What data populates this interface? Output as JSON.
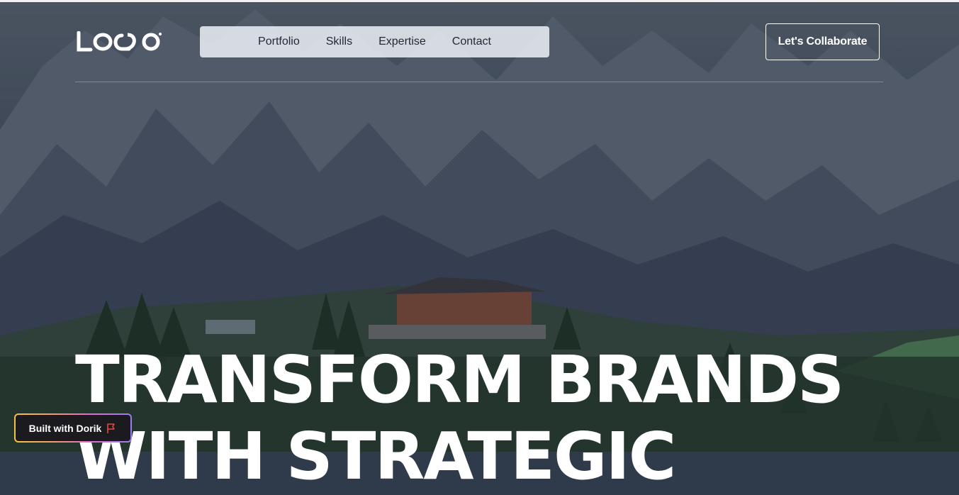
{
  "header": {
    "logo_text": "LOQO",
    "nav": [
      {
        "label": "Portfolio"
      },
      {
        "label": "Skills"
      },
      {
        "label": "Expertise"
      },
      {
        "label": "Contact"
      }
    ],
    "cta_label": "Let's Collaborate"
  },
  "hero": {
    "headline_line1": "TRANSFORM BRANDS",
    "headline_line2": "WITH STRATEGIC",
    "background": "mountain landscape with alpine lodge and pine trees"
  },
  "badge": {
    "label": "Built with Dorik",
    "icon": "flag-icon",
    "icon_color": "#e8473f"
  },
  "colors": {
    "text_on_dark": "#ffffff",
    "nav_pill": "#e8ecf2",
    "nav_text": "#222a35"
  }
}
